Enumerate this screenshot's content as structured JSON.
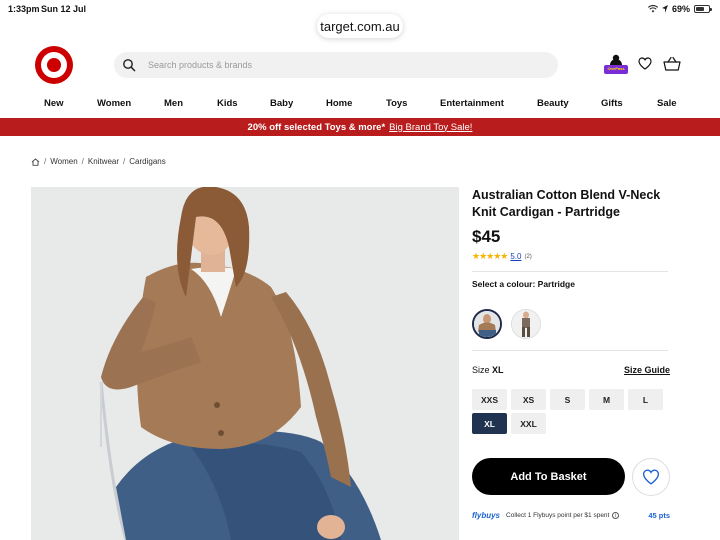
{
  "status_bar": {
    "time": "1:33pm",
    "date": "Sun 12 Jul",
    "battery": "69%",
    "battery_level": 0.69
  },
  "browser": {
    "url": "target.com.au"
  },
  "header": {
    "search_placeholder": "Search products & brands",
    "onepass_label": "OnePass"
  },
  "nav": {
    "items": [
      "New",
      "Women",
      "Men",
      "Kids",
      "Baby",
      "Home",
      "Toys",
      "Entertainment",
      "Beauty",
      "Gifts",
      "Sale"
    ]
  },
  "promo": {
    "text": "20% off selected Toys & more*",
    "link": "Big Brand Toy Sale!"
  },
  "breadcrumb": {
    "items": [
      "Women",
      "Knitwear",
      "Cardigans"
    ]
  },
  "product": {
    "title": "Australian Cotton Blend V-Neck Knit Cardigan - Partridge",
    "price": "$45",
    "rating_value": "5.0",
    "rating_count": "(2)",
    "stars": 5,
    "colour_label": "Select a colour: Partridge",
    "size_label": "Size",
    "size_selected": "XL",
    "size_guide": "Size Guide",
    "sizes_row1": [
      "XXS",
      "XS",
      "S",
      "M",
      "L"
    ],
    "sizes_row2": [
      "XL",
      "XXL"
    ],
    "add_to_basket": "Add To Basket",
    "flybuys_brand": "flybuys",
    "flybuys_text": "Collect 1 Flybuys point per $1 spent",
    "flybuys_points": "45 pts"
  },
  "colors": {
    "brand_red": "#cc0000",
    "promo_red": "#b81c1c",
    "selected_size": "#203351",
    "flybuys_blue": "#1d62d3"
  }
}
